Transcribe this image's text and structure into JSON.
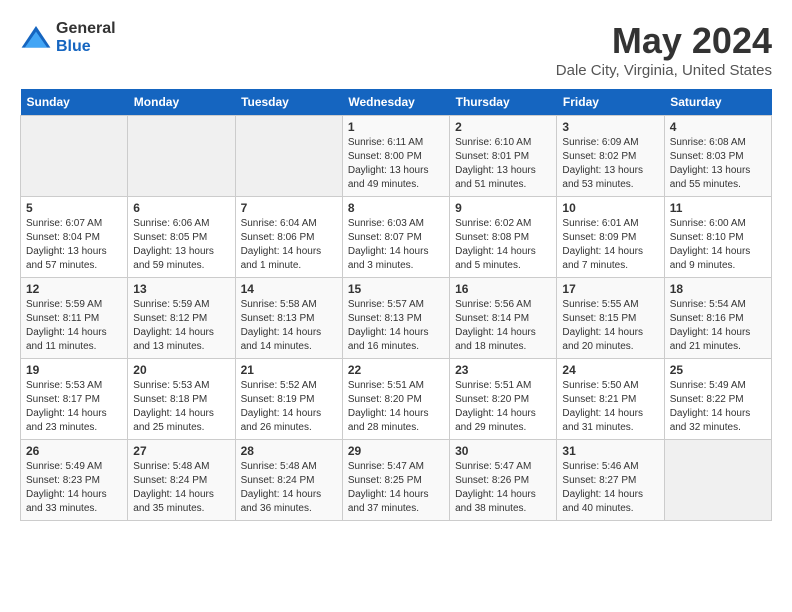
{
  "logo": {
    "general": "General",
    "blue": "Blue"
  },
  "title": "May 2024",
  "location": "Dale City, Virginia, United States",
  "days_of_week": [
    "Sunday",
    "Monday",
    "Tuesday",
    "Wednesday",
    "Thursday",
    "Friday",
    "Saturday"
  ],
  "weeks": [
    [
      {
        "day": "",
        "info": ""
      },
      {
        "day": "",
        "info": ""
      },
      {
        "day": "",
        "info": ""
      },
      {
        "day": "1",
        "info": "Sunrise: 6:11 AM\nSunset: 8:00 PM\nDaylight: 13 hours\nand 49 minutes."
      },
      {
        "day": "2",
        "info": "Sunrise: 6:10 AM\nSunset: 8:01 PM\nDaylight: 13 hours\nand 51 minutes."
      },
      {
        "day": "3",
        "info": "Sunrise: 6:09 AM\nSunset: 8:02 PM\nDaylight: 13 hours\nand 53 minutes."
      },
      {
        "day": "4",
        "info": "Sunrise: 6:08 AM\nSunset: 8:03 PM\nDaylight: 13 hours\nand 55 minutes."
      }
    ],
    [
      {
        "day": "5",
        "info": "Sunrise: 6:07 AM\nSunset: 8:04 PM\nDaylight: 13 hours\nand 57 minutes."
      },
      {
        "day": "6",
        "info": "Sunrise: 6:06 AM\nSunset: 8:05 PM\nDaylight: 13 hours\nand 59 minutes."
      },
      {
        "day": "7",
        "info": "Sunrise: 6:04 AM\nSunset: 8:06 PM\nDaylight: 14 hours\nand 1 minute."
      },
      {
        "day": "8",
        "info": "Sunrise: 6:03 AM\nSunset: 8:07 PM\nDaylight: 14 hours\nand 3 minutes."
      },
      {
        "day": "9",
        "info": "Sunrise: 6:02 AM\nSunset: 8:08 PM\nDaylight: 14 hours\nand 5 minutes."
      },
      {
        "day": "10",
        "info": "Sunrise: 6:01 AM\nSunset: 8:09 PM\nDaylight: 14 hours\nand 7 minutes."
      },
      {
        "day": "11",
        "info": "Sunrise: 6:00 AM\nSunset: 8:10 PM\nDaylight: 14 hours\nand 9 minutes."
      }
    ],
    [
      {
        "day": "12",
        "info": "Sunrise: 5:59 AM\nSunset: 8:11 PM\nDaylight: 14 hours\nand 11 minutes."
      },
      {
        "day": "13",
        "info": "Sunrise: 5:59 AM\nSunset: 8:12 PM\nDaylight: 14 hours\nand 13 minutes."
      },
      {
        "day": "14",
        "info": "Sunrise: 5:58 AM\nSunset: 8:13 PM\nDaylight: 14 hours\nand 14 minutes."
      },
      {
        "day": "15",
        "info": "Sunrise: 5:57 AM\nSunset: 8:13 PM\nDaylight: 14 hours\nand 16 minutes."
      },
      {
        "day": "16",
        "info": "Sunrise: 5:56 AM\nSunset: 8:14 PM\nDaylight: 14 hours\nand 18 minutes."
      },
      {
        "day": "17",
        "info": "Sunrise: 5:55 AM\nSunset: 8:15 PM\nDaylight: 14 hours\nand 20 minutes."
      },
      {
        "day": "18",
        "info": "Sunrise: 5:54 AM\nSunset: 8:16 PM\nDaylight: 14 hours\nand 21 minutes."
      }
    ],
    [
      {
        "day": "19",
        "info": "Sunrise: 5:53 AM\nSunset: 8:17 PM\nDaylight: 14 hours\nand 23 minutes."
      },
      {
        "day": "20",
        "info": "Sunrise: 5:53 AM\nSunset: 8:18 PM\nDaylight: 14 hours\nand 25 minutes."
      },
      {
        "day": "21",
        "info": "Sunrise: 5:52 AM\nSunset: 8:19 PM\nDaylight: 14 hours\nand 26 minutes."
      },
      {
        "day": "22",
        "info": "Sunrise: 5:51 AM\nSunset: 8:20 PM\nDaylight: 14 hours\nand 28 minutes."
      },
      {
        "day": "23",
        "info": "Sunrise: 5:51 AM\nSunset: 8:20 PM\nDaylight: 14 hours\nand 29 minutes."
      },
      {
        "day": "24",
        "info": "Sunrise: 5:50 AM\nSunset: 8:21 PM\nDaylight: 14 hours\nand 31 minutes."
      },
      {
        "day": "25",
        "info": "Sunrise: 5:49 AM\nSunset: 8:22 PM\nDaylight: 14 hours\nand 32 minutes."
      }
    ],
    [
      {
        "day": "26",
        "info": "Sunrise: 5:49 AM\nSunset: 8:23 PM\nDaylight: 14 hours\nand 33 minutes."
      },
      {
        "day": "27",
        "info": "Sunrise: 5:48 AM\nSunset: 8:24 PM\nDaylight: 14 hours\nand 35 minutes."
      },
      {
        "day": "28",
        "info": "Sunrise: 5:48 AM\nSunset: 8:24 PM\nDaylight: 14 hours\nand 36 minutes."
      },
      {
        "day": "29",
        "info": "Sunrise: 5:47 AM\nSunset: 8:25 PM\nDaylight: 14 hours\nand 37 minutes."
      },
      {
        "day": "30",
        "info": "Sunrise: 5:47 AM\nSunset: 8:26 PM\nDaylight: 14 hours\nand 38 minutes."
      },
      {
        "day": "31",
        "info": "Sunrise: 5:46 AM\nSunset: 8:27 PM\nDaylight: 14 hours\nand 40 minutes."
      },
      {
        "day": "",
        "info": ""
      }
    ]
  ]
}
